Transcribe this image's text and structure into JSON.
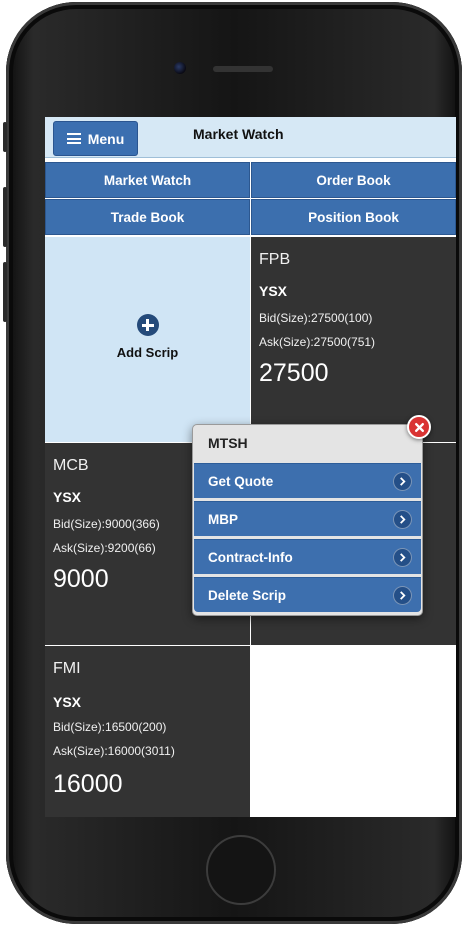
{
  "header": {
    "menu_label": "Menu",
    "title": "Market Watch"
  },
  "nav": {
    "row1": [
      "Market Watch",
      "Order Book"
    ],
    "row2": [
      "Trade Book",
      "Position Book"
    ]
  },
  "add_tile": {
    "label": "Add Scrip",
    "icon": "plus-circle-icon"
  },
  "tiles": [
    {
      "symbol": "FPB",
      "exchange": "YSX",
      "bid": "Bid(Size):27500(100)",
      "ask": "Ask(Size):27500(751)",
      "price": "27500"
    },
    {
      "symbol": "MCB",
      "exchange": "YSX",
      "bid": "Bid(Size):9000(366)",
      "ask": "Ask(Size):9200(66)",
      "price": "9000"
    },
    {
      "symbol": "FMI",
      "exchange": "YSX",
      "bid": "Bid(Size):16500(200)",
      "ask": "Ask(Size):16000(3011)",
      "price": "16000"
    }
  ],
  "popup": {
    "title": "MTSH",
    "items": [
      "Get Quote",
      "MBP",
      "Contract-Info",
      "Delete Scrip"
    ],
    "close_icon": "close-x-icon",
    "item_icon": "chevron-right-icon"
  },
  "colors": {
    "accent": "#3c6fae",
    "tile_dark": "#333333",
    "tile_light": "#d0e5f5",
    "close": "#d93333"
  }
}
